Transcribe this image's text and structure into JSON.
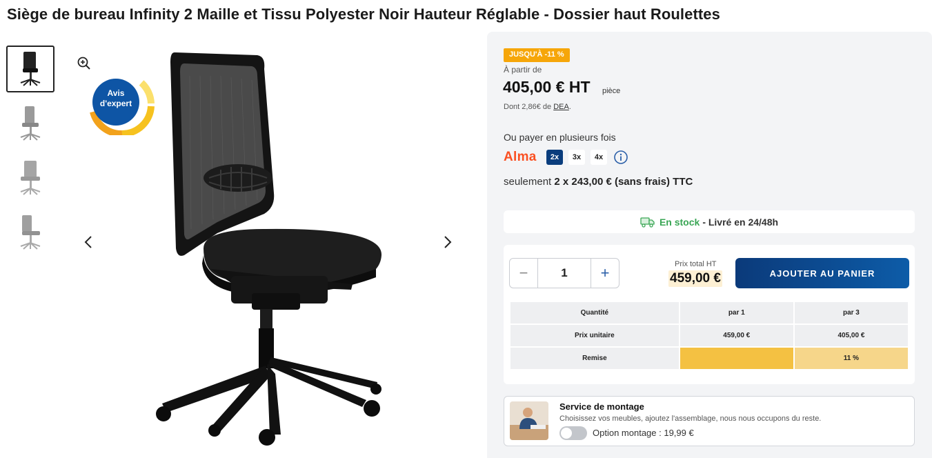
{
  "product": {
    "title": "Siège de bureau Infinity 2 Maille et Tissu Polyester Noir Hauteur Réglable - Dossier haut Roulettes"
  },
  "gallery": {
    "thumbnails": [
      "chair-front",
      "chair-side",
      "chair-back",
      "chair-three-quarter"
    ],
    "active_index": 0,
    "badge_line1": "Avis",
    "badge_line2": "d'expert"
  },
  "pricing": {
    "promo_badge": "JUSQU'À  -11 %",
    "from_label": "À partir de",
    "price": "405,00 € HT",
    "price_unit": "pièce",
    "eco_prefix": "Dont 2,86€ de",
    "eco_link": "DEA",
    "eco_suffix": "."
  },
  "installments": {
    "label": "Ou payer en plusieurs fois",
    "provider": "Alma",
    "options": [
      "2x",
      "3x",
      "4x"
    ],
    "selected": "2x",
    "summary_prefix": "seulement",
    "summary_value": "2 x 243,00 € (sans frais) TTC"
  },
  "stock": {
    "status": "En stock",
    "delivery": "- Livré en 24/48h"
  },
  "cart": {
    "quantity": "1",
    "minus": "−",
    "plus": "+",
    "total_label": "Prix total  HT",
    "total_value": "459,00 €",
    "add_button": "AJOUTER AU PANIER"
  },
  "tiers": {
    "header": [
      "Quantité",
      "par 1",
      "par 3"
    ],
    "unit_price": [
      "Prix unitaire",
      "459,00 €",
      "405,00 €"
    ],
    "discount": [
      "Remise",
      "",
      "11 %"
    ]
  },
  "service": {
    "title": "Service de montage",
    "description": "Choisissez vos meubles, ajoutez l'assemblage, nous nous occupons du reste.",
    "option_label": "Option montage : 19,99 €"
  },
  "colors": {
    "brand_blue": "#0b3a7a",
    "promo_orange": "#f6a609",
    "stock_green": "#3aa655",
    "alma_orange": "#fa5022",
    "tier_highlight": "#f4c142"
  }
}
